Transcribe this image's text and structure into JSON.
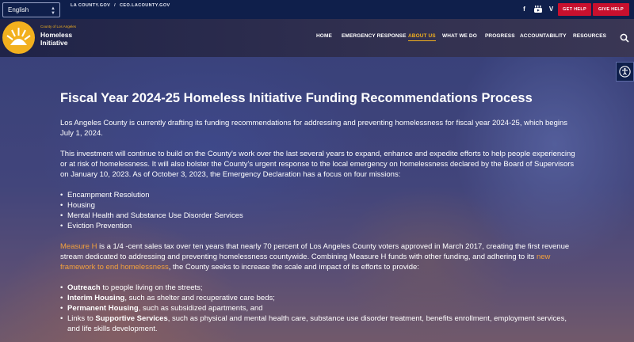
{
  "topbar": {
    "language": "English",
    "links": [
      "LA COUNTY.GOV",
      "/",
      "CEO.LACOUNTY.GOV"
    ],
    "social": [
      "facebook-icon",
      "youtube-icon",
      "vimeo-icon"
    ],
    "get_help": "GET HELP",
    "give_help": "GIVE HELP"
  },
  "header": {
    "logo_small": "County of Los Angeles",
    "logo_line1": "Homeless",
    "logo_line2": "Initiative",
    "nav": [
      "HOME",
      "EMERGENCY RESPONSE",
      "ABOUT US",
      "WHAT WE DO",
      "PROGRESS",
      "ACCOUNTABILITY",
      "RESOURCES"
    ],
    "active_nav": "ABOUT US"
  },
  "main": {
    "title": "Fiscal Year 2024-25 Homeless Initiative Funding Recommendations Process",
    "para1": "Los Angeles County is currently drafting its funding recommendations for addressing and preventing homelessness for fiscal year 2024-25, which begins July 1, 2024.",
    "para2": "This investment will continue to build on the County's work over the last several years to expand, enhance and expedite efforts to help people experiencing or at risk of homelessness. It will also bolster the County's urgent response to the local emergency on homelessness declared by the Board of Supervisors on January 10, 2023. As of October 3, 2023, the Emergency Declaration has a focus on four missions:",
    "missions": [
      "Encampment Resolution",
      "Housing",
      "Mental Health and Substance Use Disorder Services",
      "Eviction Prevention"
    ],
    "measure_h_link": "Measure H",
    "para3_a": " is a 1/4 -cent sales tax over ten years that nearly 70 percent of Los Angeles County voters approved in March 2017, creating the first revenue stream dedicated to addressing and preventing homelessness countywide. Combining Measure H funds with other funding, and adhering to its ",
    "framework_link": "new framework to end homelessness",
    "para3_b": ", the County seeks to increase the scale and impact of its efforts to provide:",
    "provides": [
      {
        "bold": "Outreach",
        "rest": " to people living on the streets;"
      },
      {
        "bold": "Interim Housing",
        "rest": ", such as shelter and recuperative care beds;"
      },
      {
        "bold": "Permanent Housing",
        "rest": ", such as subsidized apartments, and"
      },
      {
        "pre": "Links to ",
        "bold": "Supportive Services",
        "rest": ", such as physical and mental health care, substance use disorder treatment, benefits enrollment, employment services, and life skills development."
      }
    ]
  },
  "colors": {
    "accent": "#f2b01e",
    "red": "#c8102e",
    "navy": "#0f1f4b",
    "link": "#f2a03d"
  }
}
